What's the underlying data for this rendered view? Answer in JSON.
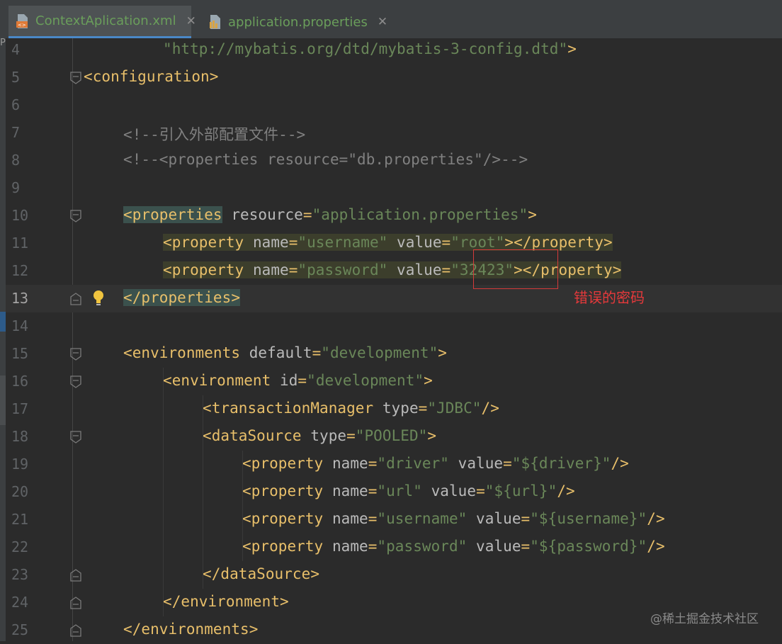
{
  "tabs": [
    {
      "label": "ContextAplication.xml",
      "active": true,
      "icon": "xml-file-icon"
    },
    {
      "label": "application.properties",
      "active": false,
      "icon": "properties-file-icon"
    }
  ],
  "side_fragment": "P",
  "lines": [
    {
      "num": "4",
      "tokens": [
        {
          "t": "val",
          "s": "\"http://mybatis.org/dtd/mybatis-3-config.dtd\""
        },
        {
          "t": "tag",
          "s": ">"
        }
      ]
    },
    {
      "num": "5",
      "tokens": [
        {
          "t": "tag",
          "s": "<configuration>"
        }
      ]
    },
    {
      "num": "6",
      "tokens": []
    },
    {
      "num": "7",
      "tokens": [
        {
          "t": "cmt",
          "s": "<!--引入外部配置文件-->"
        }
      ]
    },
    {
      "num": "8",
      "tokens": [
        {
          "t": "cmt",
          "s": "<!--<properties resource=\"db.properties\"/>-->"
        }
      ]
    },
    {
      "num": "9",
      "tokens": []
    },
    {
      "num": "10",
      "tokens": [
        {
          "t": "tag",
          "s": "<properties"
        },
        {
          "t": "attr",
          "s": " resource"
        },
        {
          "t": "tag",
          "s": "="
        },
        {
          "t": "val",
          "s": "\"application.properties\""
        },
        {
          "t": "tag",
          "s": ">"
        }
      ]
    },
    {
      "num": "11",
      "tokens": [
        {
          "t": "tag",
          "s": "<property"
        },
        {
          "t": "attr",
          "s": " name"
        },
        {
          "t": "tag",
          "s": "="
        },
        {
          "t": "val",
          "s": "\"username\""
        },
        {
          "t": "attr",
          "s": " value"
        },
        {
          "t": "tag",
          "s": "="
        },
        {
          "t": "val",
          "s": "\"root\""
        },
        {
          "t": "tag",
          "s": "></property>"
        }
      ]
    },
    {
      "num": "12",
      "tokens": [
        {
          "t": "tag",
          "s": "<property"
        },
        {
          "t": "attr",
          "s": " name"
        },
        {
          "t": "tag",
          "s": "="
        },
        {
          "t": "val",
          "s": "\"password\""
        },
        {
          "t": "attr",
          "s": " value"
        },
        {
          "t": "tag",
          "s": "="
        },
        {
          "t": "val",
          "s": "\"32423\""
        },
        {
          "t": "tag",
          "s": "></property>"
        }
      ]
    },
    {
      "num": "13",
      "tokens": [
        {
          "t": "tag",
          "s": "</properties>"
        }
      ]
    },
    {
      "num": "14",
      "tokens": []
    },
    {
      "num": "15",
      "tokens": [
        {
          "t": "tag",
          "s": "<environments"
        },
        {
          "t": "attr",
          "s": " default"
        },
        {
          "t": "tag",
          "s": "="
        },
        {
          "t": "val",
          "s": "\"development\""
        },
        {
          "t": "tag",
          "s": ">"
        }
      ]
    },
    {
      "num": "16",
      "tokens": [
        {
          "t": "tag",
          "s": "<environment"
        },
        {
          "t": "attr",
          "s": " id"
        },
        {
          "t": "tag",
          "s": "="
        },
        {
          "t": "val",
          "s": "\"development\""
        },
        {
          "t": "tag",
          "s": ">"
        }
      ]
    },
    {
      "num": "17",
      "tokens": [
        {
          "t": "tag",
          "s": "<transactionManager"
        },
        {
          "t": "attr",
          "s": " type"
        },
        {
          "t": "tag",
          "s": "="
        },
        {
          "t": "val",
          "s": "\"JDBC\""
        },
        {
          "t": "tag",
          "s": "/>"
        }
      ]
    },
    {
      "num": "18",
      "tokens": [
        {
          "t": "tag",
          "s": "<dataSource"
        },
        {
          "t": "attr",
          "s": " type"
        },
        {
          "t": "tag",
          "s": "="
        },
        {
          "t": "val",
          "s": "\"POOLED\""
        },
        {
          "t": "tag",
          "s": ">"
        }
      ]
    },
    {
      "num": "19",
      "tokens": [
        {
          "t": "tag",
          "s": "<property"
        },
        {
          "t": "attr",
          "s": " name"
        },
        {
          "t": "tag",
          "s": "="
        },
        {
          "t": "val",
          "s": "\"driver\""
        },
        {
          "t": "attr",
          "s": " value"
        },
        {
          "t": "tag",
          "s": "="
        },
        {
          "t": "val",
          "s": "\"${driver}\""
        },
        {
          "t": "tag",
          "s": "/>"
        }
      ]
    },
    {
      "num": "20",
      "tokens": [
        {
          "t": "tag",
          "s": "<property"
        },
        {
          "t": "attr",
          "s": " name"
        },
        {
          "t": "tag",
          "s": "="
        },
        {
          "t": "val",
          "s": "\"url\""
        },
        {
          "t": "attr",
          "s": " value"
        },
        {
          "t": "tag",
          "s": "="
        },
        {
          "t": "val",
          "s": "\"${url}\""
        },
        {
          "t": "tag",
          "s": "/>"
        }
      ]
    },
    {
      "num": "21",
      "tokens": [
        {
          "t": "tag",
          "s": "<property"
        },
        {
          "t": "attr",
          "s": " name"
        },
        {
          "t": "tag",
          "s": "="
        },
        {
          "t": "val",
          "s": "\"username\""
        },
        {
          "t": "attr",
          "s": " value"
        },
        {
          "t": "tag",
          "s": "="
        },
        {
          "t": "val",
          "s": "\"${username}\""
        },
        {
          "t": "tag",
          "s": "/>"
        }
      ]
    },
    {
      "num": "22",
      "tokens": [
        {
          "t": "tag",
          "s": "<property"
        },
        {
          "t": "attr",
          "s": " name"
        },
        {
          "t": "tag",
          "s": "="
        },
        {
          "t": "val",
          "s": "\"password\""
        },
        {
          "t": "attr",
          "s": " value"
        },
        {
          "t": "tag",
          "s": "="
        },
        {
          "t": "val",
          "s": "\"${password}\""
        },
        {
          "t": "tag",
          "s": "/>"
        }
      ]
    },
    {
      "num": "23",
      "tokens": [
        {
          "t": "tag",
          "s": "</dataSource>"
        }
      ]
    },
    {
      "num": "24",
      "tokens": [
        {
          "t": "tag",
          "s": "</environment>"
        }
      ]
    },
    {
      "num": "25",
      "tokens": [
        {
          "t": "tag",
          "s": "</environments>"
        }
      ]
    }
  ],
  "annotation": "错误的密码",
  "watermark": "@稀土掘金技术社区",
  "colors": {
    "tag": "#e8bf6a",
    "attr": "#bababa",
    "value": "#6a8759",
    "comment": "#808080",
    "annotation": "#e5393b"
  }
}
